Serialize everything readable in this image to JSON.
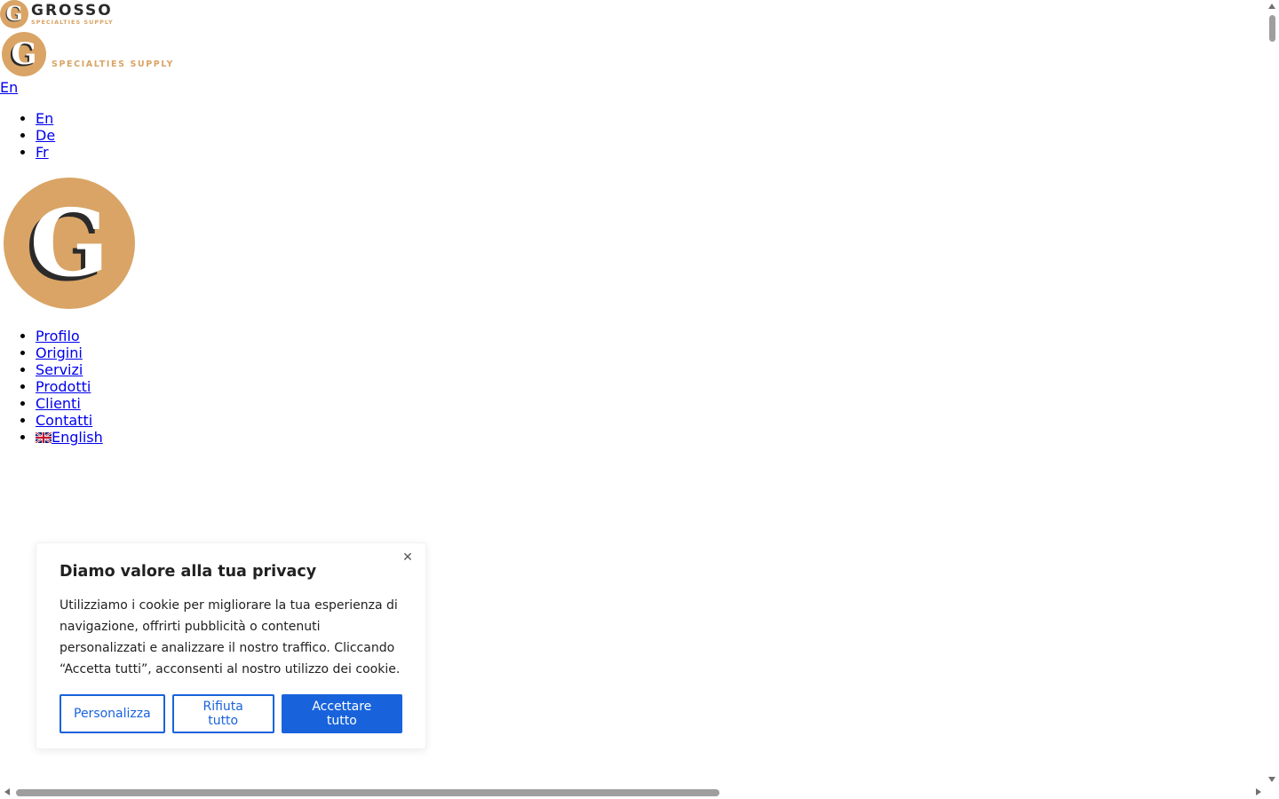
{
  "header": {
    "brand_name": "GROSSO",
    "brand_tagline": "SPECIALTIES SUPPLY",
    "logo_letter": "G",
    "current_language": "En"
  },
  "language_menu": {
    "items": [
      "En",
      "De",
      "Fr"
    ]
  },
  "main_menu": {
    "items": [
      {
        "label": "Profilo"
      },
      {
        "label": "Origini"
      },
      {
        "label": "Servizi"
      },
      {
        "label": "Prodotti"
      },
      {
        "label": "Clienti"
      },
      {
        "label": "Contatti"
      },
      {
        "label": "English",
        "icon": "uk-flag-icon"
      }
    ]
  },
  "cookie_banner": {
    "title": "Diamo valore alla tua privacy",
    "text": "Utilizziamo i cookie per migliorare la tua esperienza di navigazione, offrirti pubblicità o contenuti personalizzati e analizzare il nostro traffico. Cliccando “Accetta tutti”, acconsenti al nostro utilizzo dei cookie.",
    "close_icon": "close-icon",
    "buttons": {
      "customize": "Personalizza",
      "reject": "Rifiuta tutto",
      "accept": "Accettare tutto"
    }
  },
  "colors": {
    "brand_gold": "#d9a465",
    "brand_dark": "#2b2b2b",
    "accent_blue": "#1863dc",
    "link": "#0000ee"
  }
}
